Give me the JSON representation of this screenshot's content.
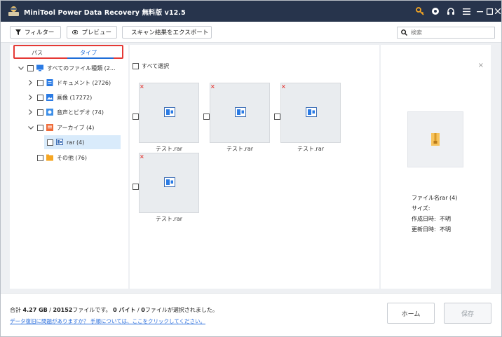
{
  "title": {
    "app_name": "MiniTool Power Data Recovery 無料版 v12.5"
  },
  "window_icons": [
    "key-icon",
    "record-icon",
    "headphones-icon",
    "menu-icon",
    "minimize-icon",
    "maximize-icon",
    "close-icon"
  ],
  "toolbar": {
    "filter_label": "フィルター",
    "preview_label": "プレビュー",
    "export_label": "スキャン結果をエクスポート",
    "search_placeholder": "検索"
  },
  "tabs": {
    "path_label": "パス",
    "type_label": "タイプ",
    "active": "type"
  },
  "tree": {
    "items": [
      {
        "label": "すべてのファイル種類 (2...",
        "icon": "monitor-icon",
        "expanded": true
      },
      {
        "label": "ドキュメント (2726)",
        "icon": "document-icon",
        "expanded": false
      },
      {
        "label": "画像 (17272)",
        "icon": "image-icon",
        "expanded": false
      },
      {
        "label": "音声とビデオ (74)",
        "icon": "media-icon",
        "expanded": false
      },
      {
        "label": "アーカイブ (4)",
        "icon": "archive-icon",
        "expanded": true
      },
      {
        "label": "rar (4)",
        "icon": "rar-icon",
        "selected": true
      },
      {
        "label": "その他 (76)",
        "icon": "folder-icon"
      }
    ]
  },
  "file_grid": {
    "select_all_label": "すべて選択",
    "files": [
      {
        "name": "テスト.rar",
        "deleted_mark": "×"
      },
      {
        "name": "テスト.rar",
        "deleted_mark": "×"
      },
      {
        "name": "テスト.rar",
        "deleted_mark": "×"
      },
      {
        "name": "テスト.rar",
        "deleted_mark": "×"
      }
    ]
  },
  "preview": {
    "close_label": "×",
    "file_name_label": "ファイル名:",
    "file_name_value": "rar (4)",
    "size_label": "サイズ:",
    "size_value": "",
    "created_label": "作成日時:",
    "created_value": "不明",
    "modified_label": "更新日時:",
    "modified_value": "不明"
  },
  "status": {
    "prefix": "合計",
    "total_size": "4.27 GB",
    "sep1": " / ",
    "file_count": "20152",
    "mid": "ファイルです。",
    "selected_bytes": "0 バイト",
    "sep2": " / ",
    "selected_files": "0",
    "suffix": "ファイルが選択されました。",
    "help_link": "データ復旧に問題がありますか？ 手順については、ここをクリックしてください。"
  },
  "buttons": {
    "home_label": "ホーム",
    "save_label": "保存"
  },
  "colors": {
    "titlebar": "#27344c",
    "accent": "#1f6ed8",
    "highlight_border": "#e53935",
    "selected_row": "#d9ebfb",
    "key_icon": "#f5a623"
  }
}
